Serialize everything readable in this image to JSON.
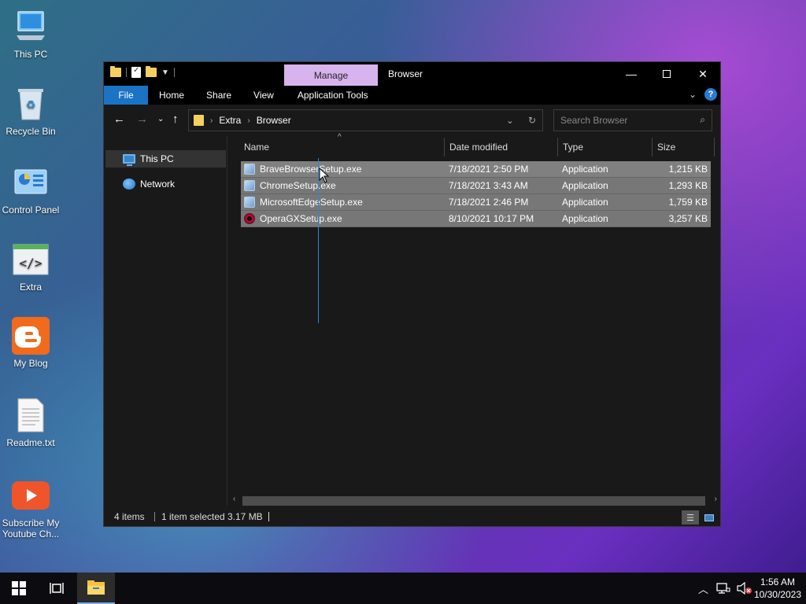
{
  "desktop": {
    "icons": [
      {
        "label": "This PC"
      },
      {
        "label": "Recycle Bin"
      },
      {
        "label": "Control Panel"
      },
      {
        "label": "Extra"
      },
      {
        "label": "My Blog"
      },
      {
        "label": "Readme.txt"
      },
      {
        "label": "Subscribe My Youtube Ch..."
      }
    ]
  },
  "window": {
    "manage_tab": "Manage",
    "title": "Browser",
    "ribbon_tabs": [
      "File",
      "Home",
      "Share",
      "View",
      "Application Tools"
    ],
    "breadcrumb": [
      "Extra",
      "Browser"
    ],
    "search_placeholder": "Search Browser",
    "nav_items": [
      "This PC",
      "Network"
    ],
    "columns": [
      "Name",
      "Date modified",
      "Type",
      "Size"
    ],
    "files": [
      {
        "name": "BraveBrowserSetup.exe",
        "date": "7/18/2021 2:50 PM",
        "type": "Application",
        "size": "1,215 KB",
        "icon": "setup-icon"
      },
      {
        "name": "ChromeSetup.exe",
        "date": "7/18/2021 3:43 AM",
        "type": "Application",
        "size": "1,293 KB",
        "icon": "setup-icon"
      },
      {
        "name": "MicrosoftEdgeSetup.exe",
        "date": "7/18/2021 2:46 PM",
        "type": "Application",
        "size": "1,759 KB",
        "icon": "setup-icon"
      },
      {
        "name": "OperaGXSetup.exe",
        "date": "8/10/2021 10:17 PM",
        "type": "Application",
        "size": "3,257 KB",
        "icon": "opera-gx-icon"
      }
    ],
    "status": {
      "items": "4 items",
      "selected": "1 item selected",
      "size": "3.17 MB"
    }
  },
  "taskbar": {
    "time": "1:56 AM",
    "date": "10/30/2023"
  },
  "colors": {
    "file_tab": "#1a73c4",
    "manage_tab": "#d8b4ee",
    "selection": "#777777"
  }
}
